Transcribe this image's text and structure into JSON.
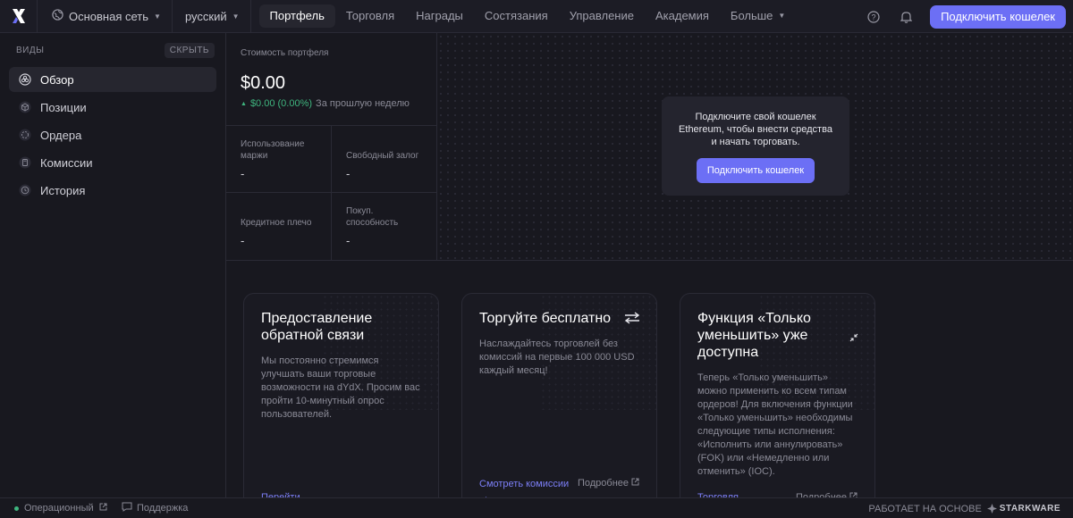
{
  "topbar": {
    "network": "Основная сеть",
    "language": "русский",
    "nav": [
      {
        "label": "Портфель",
        "active": true
      },
      {
        "label": "Торговля"
      },
      {
        "label": "Награды"
      },
      {
        "label": "Состязания"
      },
      {
        "label": "Управление"
      },
      {
        "label": "Академия"
      }
    ],
    "more": "Больше",
    "connect_button": "Подключить кошелек"
  },
  "sidebar": {
    "title": "ВИДЫ",
    "hide": "СКРЫТЬ",
    "items": [
      {
        "label": "Обзор",
        "icon": "overview-icon",
        "active": true
      },
      {
        "label": "Позиции",
        "icon": "cube-icon"
      },
      {
        "label": "Ордера",
        "icon": "orders-icon"
      },
      {
        "label": "Комиссии",
        "icon": "calculator-icon"
      },
      {
        "label": "История",
        "icon": "history-icon"
      }
    ]
  },
  "portfolio": {
    "label": "Стоимость портфеля",
    "value": "$0.00",
    "change": "$0.00 (0.00%)",
    "period": "За прошлую неделю",
    "stats": [
      {
        "label": "Использование маржи",
        "value": "-"
      },
      {
        "label": "Свободный залог",
        "value": "-"
      },
      {
        "label": "Кредитное плечо",
        "value": "-"
      },
      {
        "label": "Покуп. способность",
        "value": "-"
      }
    ]
  },
  "connect_panel": {
    "text": "Подключите свой кошелек Ethereum, чтобы внести средства и начать торговать.",
    "button": "Подключить кошелек"
  },
  "cards": [
    {
      "title": "Предоставление обратной связи",
      "body": "Мы постоянно стремимся улучшать ваши торговые возможности на dYdX. Просим вас пройти 10-минутный опрос пользователей.",
      "link": "Перейти →",
      "secondary": ""
    },
    {
      "title": "Торгуйте бесплатно",
      "body": "Наслаждайтесь торговлей без комиссий на первые 100 000 USD каждый месяц!",
      "link": "Смотреть комиссии →",
      "secondary": "Подробнее",
      "icon": "swap-arrows-icon"
    },
    {
      "title": "Функция «Только уменьшить» уже доступна",
      "body": "Теперь «Только уменьшить» можно применить ко всем типам ордеров! Для включения функции «Только уменьшить» необходимы следующие типы исполнения: «Исполнить или аннулировать» (FOK) или «Немедленно или отменить» (IOC).",
      "link": "Торговля →",
      "secondary": "Подробнее",
      "icon": "shrink-arrows-icon"
    }
  ],
  "footer": {
    "status": "Операционный",
    "support": "Поддержка",
    "powered": "РАБОТАЕТ НА ОСНОВЕ",
    "brand": "STARKWARE"
  },
  "colors": {
    "accent": "#6c6ff5",
    "positive": "#3fb67f",
    "background": "#18181f"
  }
}
